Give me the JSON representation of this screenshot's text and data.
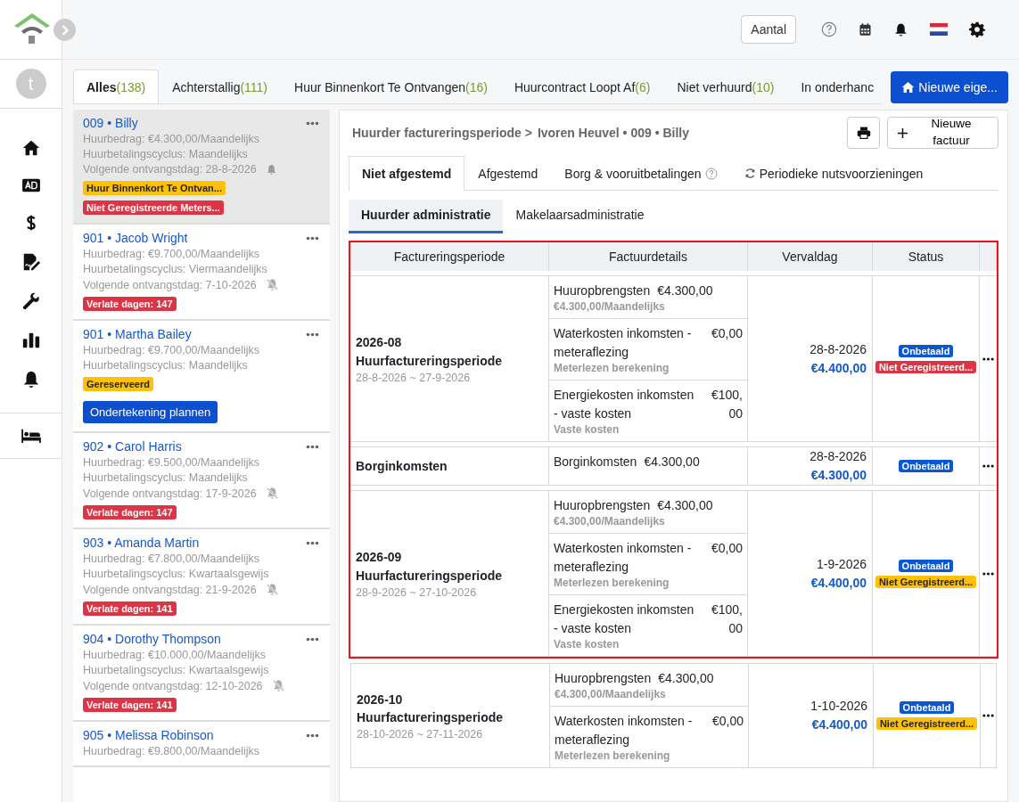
{
  "sidebar": {
    "avatar": "t"
  },
  "header": {
    "count_button": "Aantal"
  },
  "tabs": [
    {
      "label": "Alles",
      "count": "(138)",
      "selected": true
    },
    {
      "label": "Achterstallig",
      "count": "(111)",
      "selected": false
    },
    {
      "label": "Huur Binnenkort Te Ontvangen",
      "count": "(16)",
      "selected": false
    },
    {
      "label": "Huurcontract Loopt Af",
      "count": "(6)",
      "selected": false
    },
    {
      "label": "Niet verhuurd",
      "count": "(10)",
      "selected": false
    },
    {
      "label": "In onderhanc",
      "selected": false
    }
  ],
  "new_property_button": "Nieuwe eige...",
  "tenants": [
    {
      "title": "009 • Billy",
      "selected": true,
      "lines": [
        "Huurbedrag: €4.300,00/Maandelijks",
        "Huurbetalingscyclus: Maandelijks"
      ],
      "next_date": "Volgende ontvangstdag:  28-8-2026",
      "reminder": true,
      "badges": [
        {
          "label": "Huur Binnenkort Te Ontvan...",
          "color": "#ffc107"
        },
        {
          "label": "Niet Geregistreerde Meters...",
          "color": "#dc3545"
        }
      ]
    },
    {
      "title": "901 • Jacob Wright",
      "selected": false,
      "lines": [
        "Huurbedrag: €9.700,00/Maandelijks",
        "Huurbetalingscyclus: Viermaandelijks"
      ],
      "next_date": "Volgende ontvangstdag:  7-10-2026",
      "reminder": false,
      "badges": [
        {
          "label": "Verlate dagen: 147",
          "color": "#dc3545"
        }
      ]
    },
    {
      "title": "901 • Martha Bailey",
      "selected": false,
      "lines": [
        "Huurbedrag: €9.700,00/Maandelijks",
        "Huurbetalingscyclus: Maandelijks"
      ],
      "badges": [
        {
          "label": "Gereserveerd",
          "color": "#ffc107"
        }
      ],
      "button": "Ondertekening plannen"
    },
    {
      "title": "902 • Carol Harris",
      "selected": false,
      "lines": [
        "Huurbedrag: €9.500,00/Maandelijks",
        "Huurbetalingscyclus: Maandelijks"
      ],
      "next_date": "Volgende ontvangstdag:  17-9-2026",
      "reminder": false,
      "badges": [
        {
          "label": "Verlate dagen: 147",
          "color": "#dc3545"
        }
      ]
    },
    {
      "title": "903 • Amanda Martin",
      "selected": false,
      "lines": [
        "Huurbedrag: €7.800,00/Maandelijks",
        "Huurbetalingscyclus: Kwartaalsgewijs"
      ],
      "next_date": "Volgende ontvangstdag:  21-9-2026",
      "reminder": false,
      "badges": [
        {
          "label": "Verlate dagen: 141",
          "color": "#dc3545"
        }
      ]
    },
    {
      "title": "904 • Dorothy Thompson",
      "selected": false,
      "lines": [
        "Huurbedrag: €10.000,00/Maandelijks",
        "Huurbetalingscyclus: Kwartaalsgewijs"
      ],
      "next_date": "Volgende ontvangstdag:  12-10-2026",
      "reminder": false,
      "badges": [
        {
          "label": "Verlate dagen: 141",
          "color": "#dc3545"
        }
      ]
    },
    {
      "title": "905 • Melissa Robinson",
      "selected": false,
      "lines": [
        "Huurbedrag: €9.800,00/Maandelijks"
      ]
    }
  ],
  "detail": {
    "breadcrumb": [
      "Huurder factureringsperiode >",
      "Ivoren Heuvel • 009 • Billy"
    ],
    "new_invoice_button": "Nieuwe factuur",
    "tabs": [
      {
        "label": "Niet afgestemd",
        "selected": true
      },
      {
        "label": "Afgestemd",
        "selected": false
      },
      {
        "label": "Borg & vooruitbetalingen",
        "selected": false,
        "help": true
      },
      {
        "label": "Periodieke nutsvoorzieningen",
        "selected": false,
        "refresh": true
      }
    ],
    "subtabs": [
      {
        "label": "Huurder administratie",
        "selected": true
      },
      {
        "label": "Makelaarsadministratie",
        "selected": false
      }
    ],
    "table": {
      "columns": [
        "Factureringsperiode",
        "Factuurdetails",
        "Vervaldag",
        "Status"
      ],
      "rows": [
        {
          "highlighted": true,
          "period": "2026-08 Huurfactureringsperiode",
          "range": "28-8-2026 ~ 27-9-2026",
          "details": [
            {
              "name": "Huuropbrengsten",
              "amount": "€4.300,00",
              "note": "€4.300,00/Maandelijks"
            },
            {
              "name": "Waterkosten inkomsten - meteraflezing",
              "amount": "€0,00",
              "note": "Meterlezen berekening"
            },
            {
              "name": "Energiekosten inkomsten - vaste kosten",
              "amount": "€100,00",
              "note": "Vaste kosten"
            }
          ],
          "due": "28-8-2026",
          "total": "€4.400,00",
          "statuses": [
            {
              "label": "Onbetaald",
              "color": "#0b57d0"
            },
            {
              "label": "Niet Geregistreerd...",
              "color": "#dc3545"
            }
          ]
        },
        {
          "highlighted": true,
          "period": "Borginkomsten",
          "details": [
            {
              "name": "Borginkomsten",
              "amount": "€4.300,00"
            }
          ],
          "due": "28-8-2026",
          "total": "€4.300,00",
          "statuses": [
            {
              "label": "Onbetaald",
              "color": "#0b57d0"
            }
          ]
        },
        {
          "highlighted": true,
          "period": "2026-09 Huurfactureringsperiode",
          "range": "28-9-2026 ~ 27-10-2026",
          "details": [
            {
              "name": "Huuropbrengsten",
              "amount": "€4.300,00",
              "note": "€4.300,00/Maandelijks"
            },
            {
              "name": "Waterkosten inkomsten - meteraflezing",
              "amount": "€0,00",
              "note": "Meterlezen berekening"
            },
            {
              "name": "Energiekosten inkomsten - vaste kosten",
              "amount": "€100,00",
              "note": "Vaste kosten"
            }
          ],
          "due": "1-9-2026",
          "total": "€4.400,00",
          "statuses": [
            {
              "label": "Onbetaald",
              "color": "#0b57d0"
            },
            {
              "label": "Niet Geregistreerd...",
              "color": "#ffc107"
            }
          ]
        },
        {
          "highlighted": false,
          "period": "2026-10 Huurfactureringsperiode",
          "range": "28-10-2026 ~ 27-11-2026",
          "details": [
            {
              "name": "Huuropbrengsten",
              "amount": "€4.300,00",
              "note": "€4.300,00/Maandelijks"
            },
            {
              "name": "Waterkosten inkomsten - meteraflezing",
              "amount": "€0,00",
              "note": "Meterlezen berekening"
            }
          ],
          "due": "1-10-2026",
          "total": "€4.400,00",
          "statuses": [
            {
              "label": "Onbetaald",
              "color": "#0b57d0"
            },
            {
              "label": "Niet Geregistreerd...",
              "color": "#ffc107"
            }
          ]
        }
      ]
    }
  }
}
